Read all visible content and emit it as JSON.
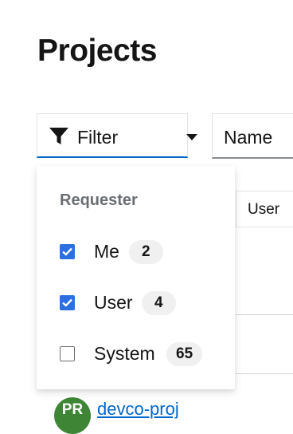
{
  "page": {
    "title": "Projects"
  },
  "toolbar": {
    "filter": {
      "label": "Filter",
      "icon": "filter-icon",
      "caret_icon": "caret-down-icon"
    },
    "attribute_select": {
      "label": "Name"
    }
  },
  "filter_menu": {
    "group_title": "Requester",
    "items": [
      {
        "label": "Me",
        "count": "2",
        "checked": true
      },
      {
        "label": "User",
        "count": "4",
        "checked": true
      },
      {
        "label": "System",
        "count": "65",
        "checked": false
      }
    ]
  },
  "table": {
    "visible_chip": "User",
    "first_row": {
      "avatar_initials": "PR",
      "project_name": "devco-proj"
    }
  },
  "colors": {
    "accent": "#0066cc",
    "checkbox": "#2b6fe0",
    "avatar": "#3e8635",
    "badge_bg": "#f0f0f0"
  }
}
